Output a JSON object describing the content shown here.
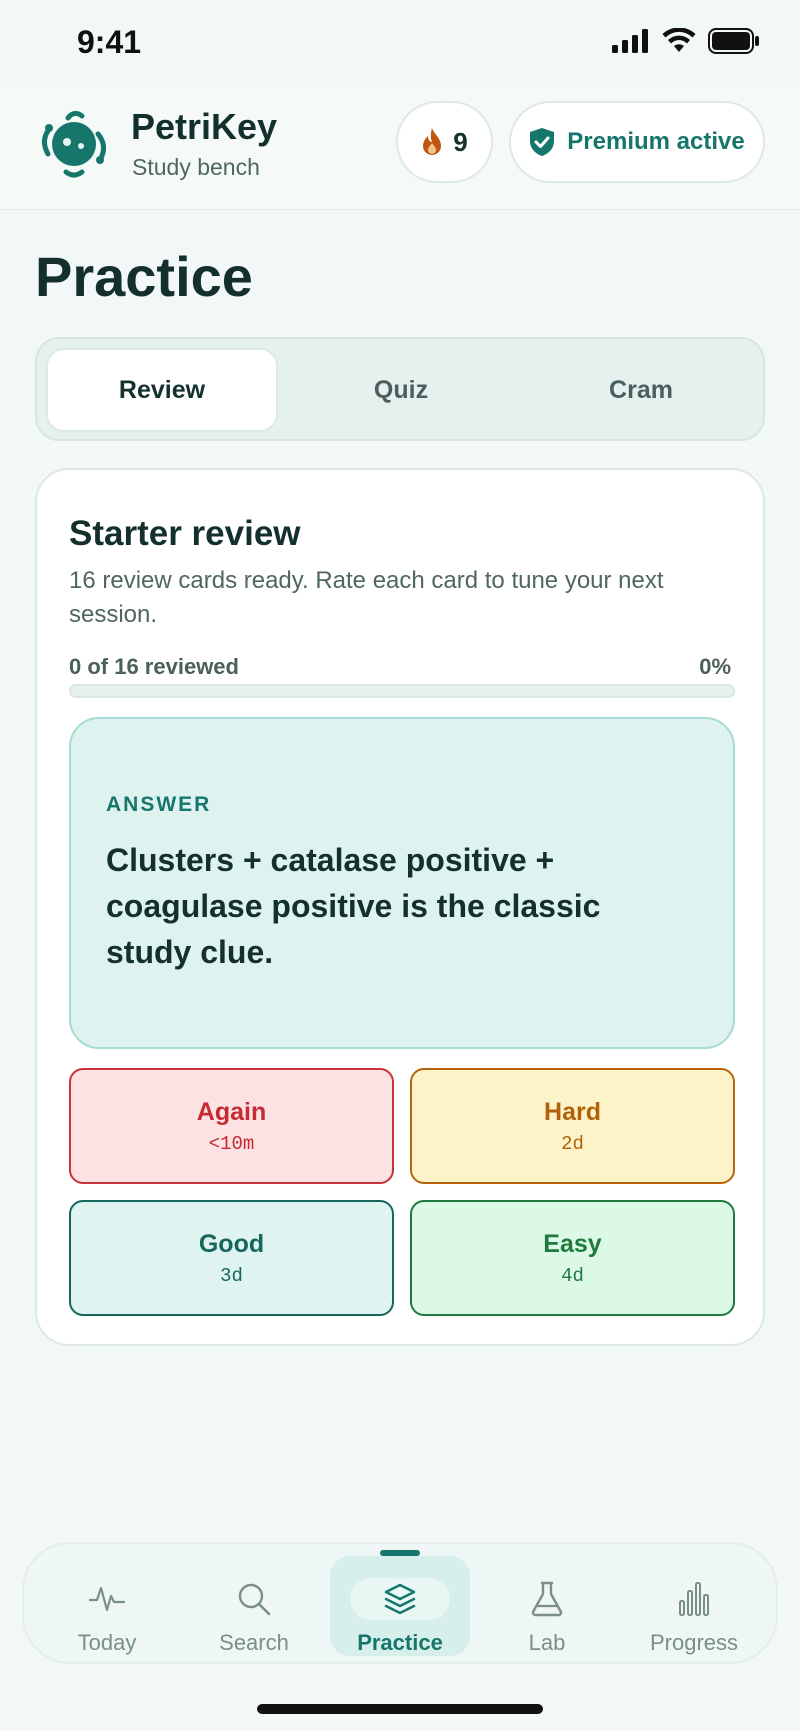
{
  "status_bar": {
    "time": "9:41"
  },
  "header": {
    "app_name": "PetriKey",
    "subtitle": "Study bench",
    "streak_count": "9",
    "premium_label": "Premium active"
  },
  "page": {
    "title": "Practice"
  },
  "mode_tabs": [
    {
      "label": "Review",
      "active": true
    },
    {
      "label": "Quiz",
      "active": false
    },
    {
      "label": "Cram",
      "active": false
    }
  ],
  "review_card": {
    "title": "Starter review",
    "description": "16 review cards ready. Rate each card to tune your next session.",
    "progress_label": "0 of 16 reviewed",
    "progress_percent_text": "0%",
    "progress_fraction": 0,
    "answer_label": "ANSWER",
    "answer_text": "Clusters + catalase positive + coagulase positive is the classic study clue.",
    "ratings": [
      {
        "label": "Again",
        "interval": "<10m"
      },
      {
        "label": "Hard",
        "interval": "2d"
      },
      {
        "label": "Good",
        "interval": "3d"
      },
      {
        "label": "Easy",
        "interval": "4d"
      }
    ]
  },
  "bottom_nav": [
    {
      "label": "Today",
      "icon": "pulse-icon",
      "active": false
    },
    {
      "label": "Search",
      "icon": "search-icon",
      "active": false
    },
    {
      "label": "Practice",
      "icon": "layers-icon",
      "active": true
    },
    {
      "label": "Lab",
      "icon": "flask-icon",
      "active": false
    },
    {
      "label": "Progress",
      "icon": "bar-chart-icon",
      "active": false
    }
  ],
  "colors": {
    "accent": "#17766c",
    "background": "#f2f8f7",
    "again": "#c52b35",
    "hard": "#b3600b",
    "good": "#17665e",
    "easy": "#1f7a3f",
    "streak_flame": "#c2560f"
  }
}
